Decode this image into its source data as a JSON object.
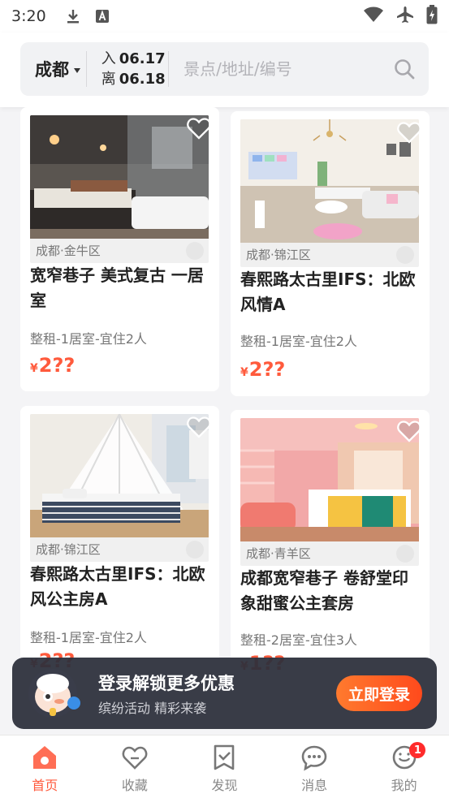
{
  "status_bar": {
    "time": "3:20"
  },
  "search": {
    "city": "成都",
    "checkin_label": "入",
    "checkin_date": "06.17",
    "checkout_label": "离",
    "checkout_date": "06.18",
    "placeholder": "景点/地址/编号"
  },
  "listings": [
    {
      "district": "成都·金牛区",
      "title": "宽窄巷子 美式复古 一居室",
      "meta": "整租-1居室-宜住2人",
      "price_symbol": "¥",
      "price": "2??"
    },
    {
      "district": "成都·锦江区",
      "title": "春熙路太古里IFS：北欧风情A",
      "meta": "整租-1居室-宜住2人",
      "price_symbol": "¥",
      "price": "2??"
    },
    {
      "district": "成都·锦江区",
      "title": "春熙路太古里IFS：北欧风公主房A",
      "meta": "整租-1居室-宜住2人",
      "price_symbol": "¥",
      "price": "2??"
    },
    {
      "district": "成都·青羊区",
      "title": "成都宽窄巷子 卷舒堂印象甜蜜公主套房",
      "meta": "整租-2居室-宜住3人",
      "price_symbol": "¥",
      "price": "1??"
    }
  ],
  "login_banner": {
    "title": "登录解锁更多优惠",
    "subtitle": "缤纷活动 精彩来袭",
    "button": "立即登录"
  },
  "tabs": [
    {
      "label": "首页",
      "active": true
    },
    {
      "label": "收藏"
    },
    {
      "label": "发现"
    },
    {
      "label": "消息"
    },
    {
      "label": "我的",
      "badge": "1"
    }
  ],
  "colors": {
    "accent": "#ff5a3c",
    "banner_bg": "#2d303c",
    "badge": "#ff2b2b"
  }
}
